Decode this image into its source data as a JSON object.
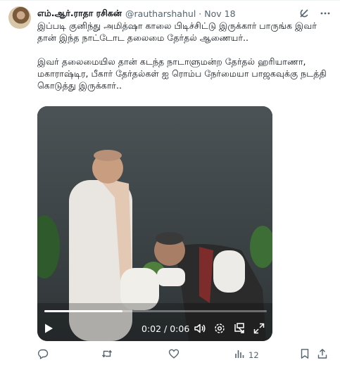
{
  "tweet": {
    "display_name": "எம்.ஆர்.ராதா ரசிகன்",
    "handle": "@rautharshahul",
    "separator": "·",
    "date": "Nov 18",
    "text": "இப்படி குனிந்து அமித்ஷா காலை பிடிச்சிட்டு இருக்கார் பாருங்க இவர் தான் இந்த நாட்டோட தலைமை தேர்தல் ஆணையர்..\n\nஇவர் தலைமையில தான் கடந்த நாடாளுமன்ற தேர்தல் ஹரியாணா, மகாராஷ்டிர, பீகார் தேர்தல்கள் ஐ ரொம்ப நேர்மையா பாஜகவுக்கு நடத்தி கொடுத்து இருக்கார்.."
  },
  "video": {
    "current_time": "0:02",
    "total_time": "0:06",
    "time_display": "0:02 / 0:06",
    "progress_fraction": 0.35
  },
  "actions": {
    "reply_count": "",
    "retweet_count": "",
    "like_count": "",
    "views_count": "12"
  },
  "icons": {
    "grok": "grok-icon",
    "more": "more-icon",
    "play": "play-icon",
    "volume": "volume-icon",
    "settings": "settings-icon",
    "pip": "picture-in-picture-icon",
    "fullscreen": "fullscreen-icon",
    "reply": "reply-icon",
    "retweet": "retweet-icon",
    "like": "like-icon",
    "views": "views-icon",
    "bookmark": "bookmark-icon",
    "share": "share-icon"
  },
  "colors": {
    "text_primary": "#0f1419",
    "text_secondary": "#536471",
    "background": "#ffffff"
  }
}
